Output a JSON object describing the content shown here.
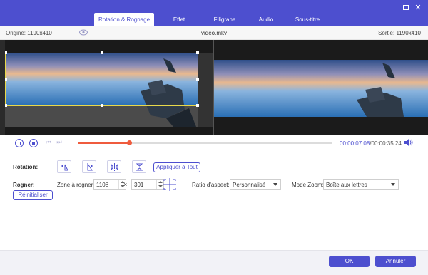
{
  "tabs": [
    "Rotation & Rognage",
    "Effet",
    "Filigrane",
    "Audio",
    "Sous-titre"
  ],
  "window_controls": {
    "maximize": "□",
    "close": "✕"
  },
  "info": {
    "original": "Origine: 1190x410",
    "filename": "video.mkv",
    "output": "Sortie: 1190x410"
  },
  "playback": {
    "progress_fraction": 0.2,
    "current_time": "00:00:07.08",
    "separator": "/",
    "total_time": "00:00:35.24",
    "skip_prev": "⏮",
    "skip_next": "⏭"
  },
  "rotation": {
    "label": "Rotation:",
    "apply_all": "Appliquer à Tout"
  },
  "crop": {
    "label": "Rogner:",
    "zone_label": "Zone à rogner:",
    "width": "1108",
    "times": "×",
    "height": "301",
    "reset": "Réinitialiser"
  },
  "aspect": {
    "label": "Ratio d'aspect:",
    "value": "Personnalisé"
  },
  "zoom": {
    "label": "Mode Zoom:",
    "value": "Boîte aux lettres"
  },
  "footer": {
    "ok": "OK",
    "cancel": "Annuler"
  },
  "colors": {
    "accent": "#4d4fcf",
    "progress": "#ef5b3d",
    "crop_frame": "#e8d84a"
  }
}
